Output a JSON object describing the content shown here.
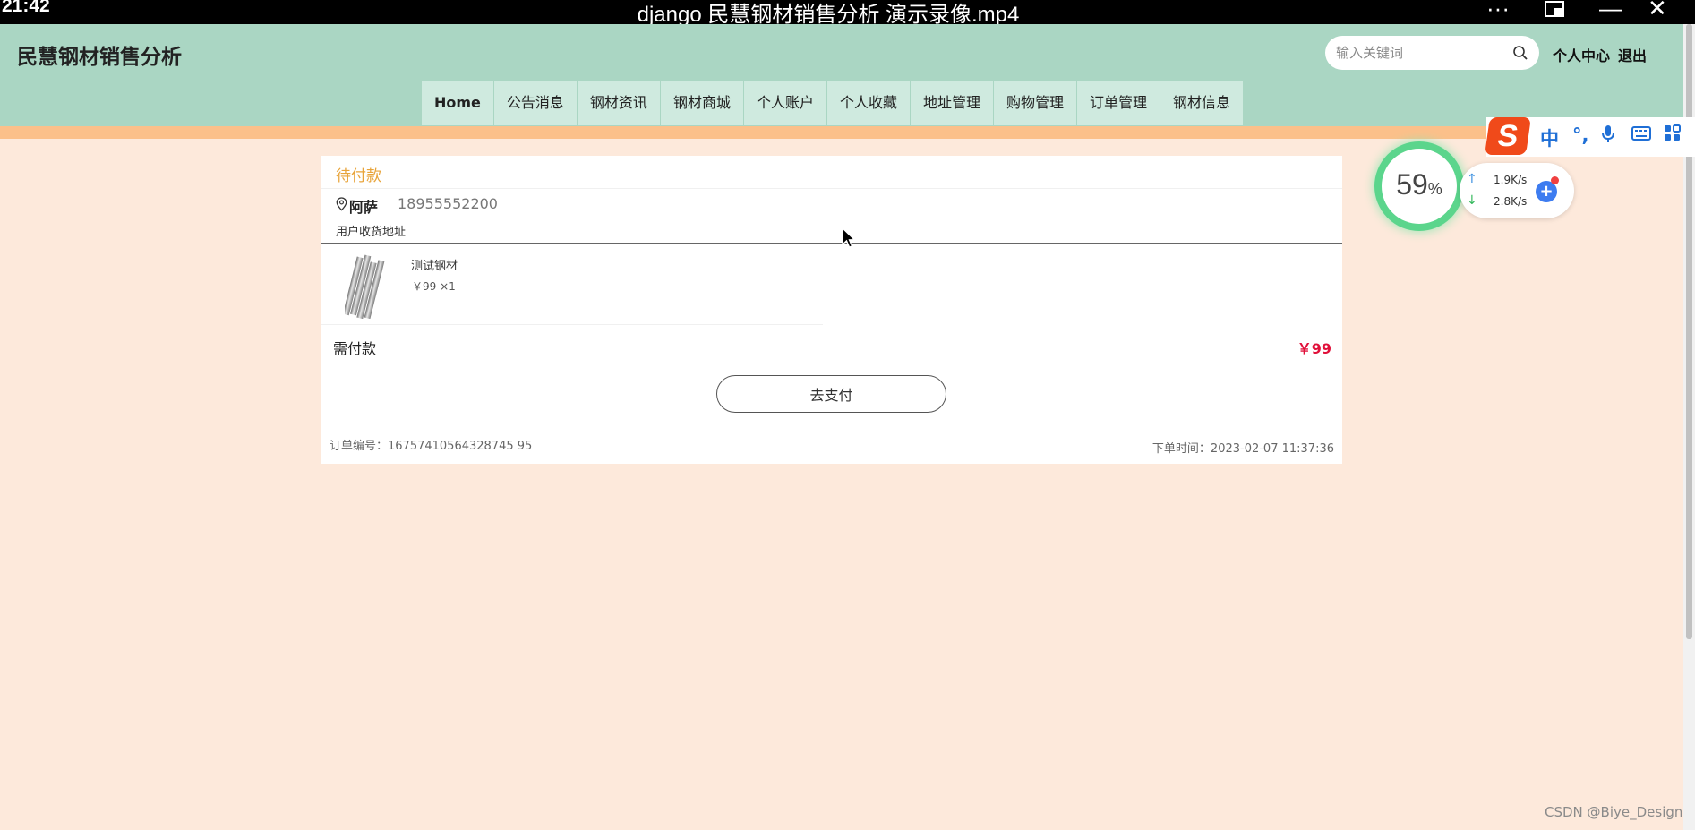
{
  "video": {
    "clock": "21:42",
    "title": "django 民慧钢材销售分析 演示录像.mp4",
    "more": "···",
    "minimize": "—",
    "close": "✕"
  },
  "header": {
    "brand": "民慧钢材销售分析",
    "search_placeholder": "输入关键词",
    "personal_center": "个人中心",
    "logout": "退出"
  },
  "nav": {
    "items": [
      "Home",
      "公告消息",
      "钢材资讯",
      "钢材商城",
      "个人账户",
      "个人收藏",
      "地址管理",
      "购物管理",
      "订单管理",
      "钢材信息"
    ]
  },
  "order": {
    "status": "待付款",
    "recipient": "阿萨",
    "phone": "18955552200",
    "address": "用户收货地址",
    "product_name": "测试钢材",
    "product_price_qty": "￥99 ×1",
    "due_label": "需付款",
    "total": "￥99",
    "pay_button": "去支付",
    "order_number": "订单编号：16757410564328745 95",
    "order_time": "下单时间：2023-02-07 11:37:36"
  },
  "ime": {
    "logo": "S",
    "lang": "中",
    "punct": "°,"
  },
  "net_monitor": {
    "percent": "59",
    "percent_sign": "%",
    "upload": "1.9K/s",
    "download": "2.8K/s"
  },
  "watermark": "CSDN @Biye_Design",
  "colors": {
    "header_bg": "#aad6c3",
    "nav_bg": "#cfeadf",
    "band": "#fbc08a",
    "page_bg": "#fde9db",
    "status": "#e8a43a",
    "total": "#e0103a"
  }
}
